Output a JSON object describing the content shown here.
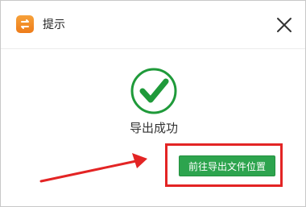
{
  "window": {
    "title": "提示",
    "app_icon": "app-logo-icon",
    "close_icon": "close-icon"
  },
  "message": {
    "icon": "success-check-icon",
    "text": "导出成功"
  },
  "actions": {
    "open_location_label": "前往导出文件位置"
  },
  "annotations": {
    "highlight_color": "#e32424",
    "arrow_color": "#e32424"
  },
  "colors": {
    "success_green": "#1f9a3a",
    "button_green": "#2da44e",
    "app_icon_orange": "#f0861f"
  }
}
